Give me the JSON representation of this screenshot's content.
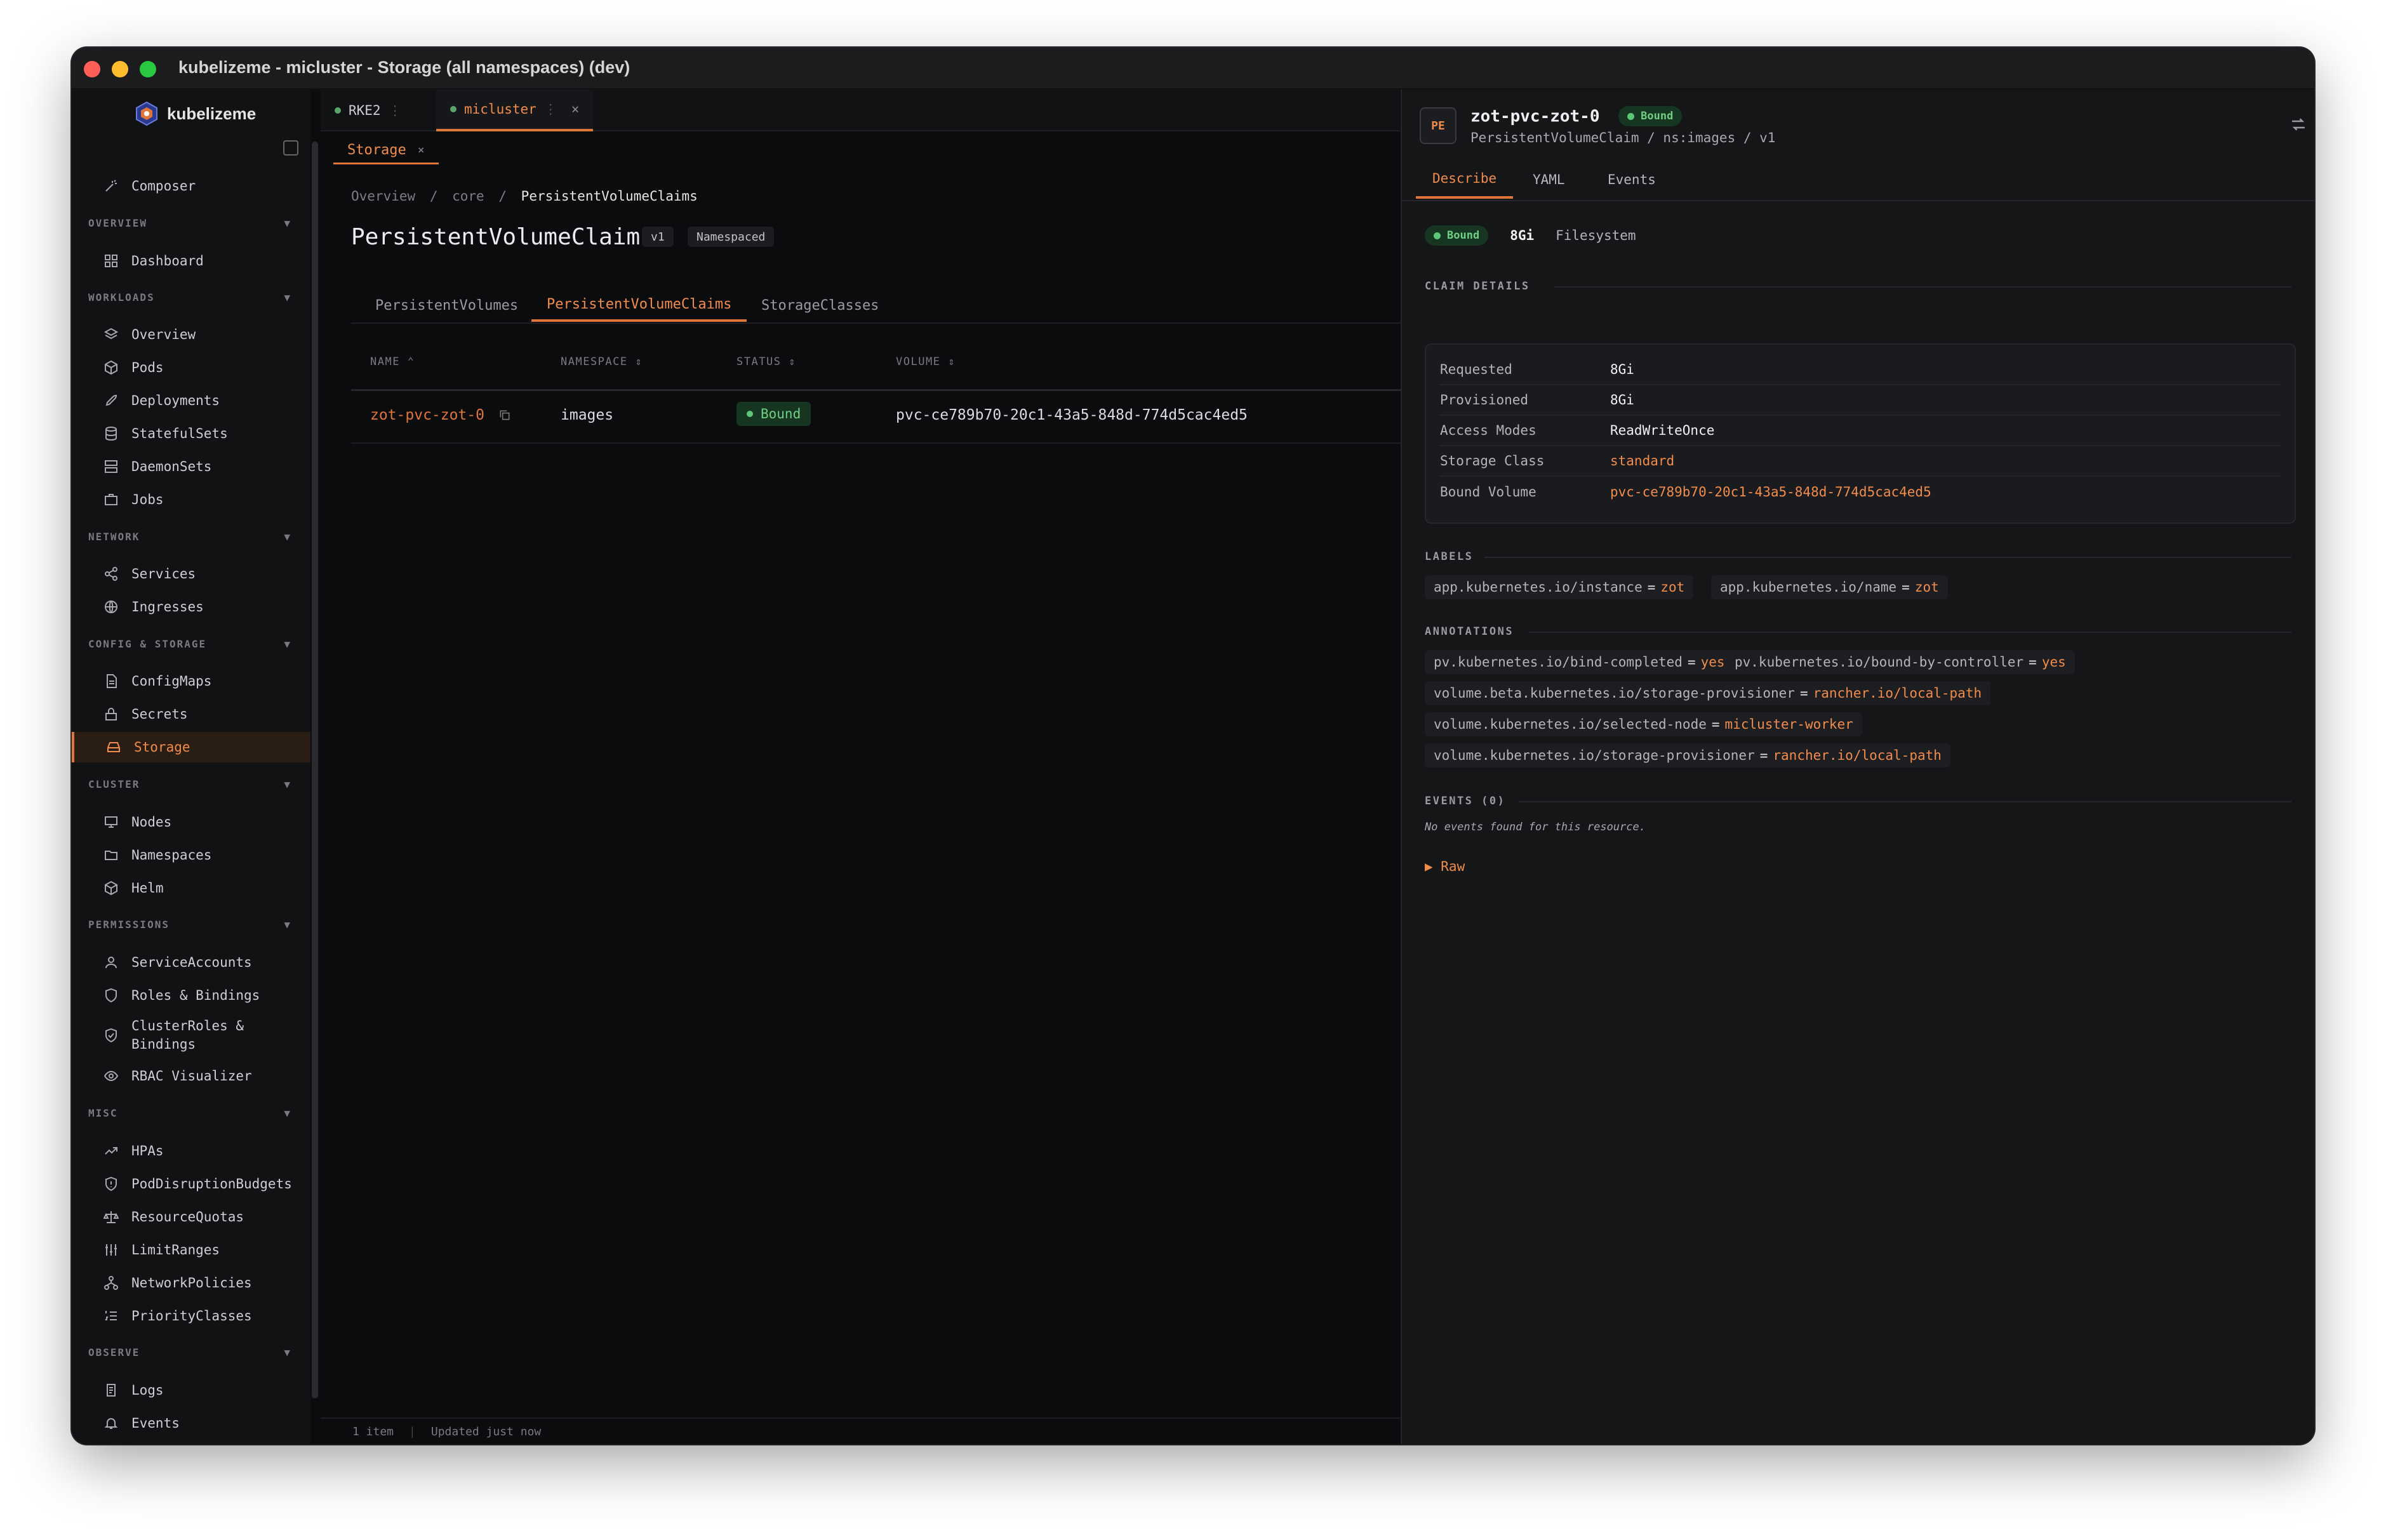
{
  "window": {
    "title": "kubelizeme - micluster - Storage (all namespaces) (dev)",
    "colors": {
      "red": "#ff5f57",
      "yellow": "#febc2e",
      "green": "#28c840"
    }
  },
  "app": {
    "name": "kubelizeme"
  },
  "sidebar": {
    "composer": "Composer",
    "sections": {
      "overview": "OVERVIEW",
      "workloads": "WORKLOADS",
      "network": "NETWORK",
      "config": "CONFIG & STORAGE",
      "cluster": "CLUSTER",
      "permissions": "PERMISSIONS",
      "misc": "MISC",
      "observe": "OBSERVE"
    },
    "chevron": "▼",
    "items": {
      "dashboard": "Dashboard",
      "overview": "Overview",
      "pods": "Pods",
      "deployments": "Deployments",
      "statefulsets": "StatefulSets",
      "daemonsets": "DaemonSets",
      "jobs": "Jobs",
      "services": "Services",
      "ingresses": "Ingresses",
      "configmaps": "ConfigMaps",
      "secrets": "Secrets",
      "storage": "Storage",
      "nodes": "Nodes",
      "namespaces": "Namespaces",
      "helm": "Helm",
      "serviceaccounts": "ServiceAccounts",
      "roles": "Roles & Bindings",
      "clusterroles_1": "ClusterRoles &",
      "clusterroles_2": "Bindings",
      "rbac": "RBAC Visualizer",
      "hpas": "HPAs",
      "pdb": "PodDisruptionBudgets",
      "quotas": "ResourceQuotas",
      "limits": "LimitRanges",
      "netpol": "NetworkPolicies",
      "priority": "PriorityClasses",
      "logs": "Logs",
      "events": "Events"
    }
  },
  "cluster_tabs": [
    {
      "label": "RKE2",
      "sep": "⋮"
    },
    {
      "label": "micluster",
      "sep": "⋮",
      "close": "×"
    }
  ],
  "view_tab": {
    "label": "Storage",
    "close": "×"
  },
  "breadcrumb": {
    "a": "Overview",
    "b": "core",
    "c": "PersistentVolumeClaims",
    "sep": "/"
  },
  "page": {
    "title": "PersistentVolumeClaims",
    "version": "v1",
    "scope": "Namespaced"
  },
  "resource_tabs": [
    "PersistentVolumes",
    "PersistentVolumeClaims",
    "StorageClasses"
  ],
  "table": {
    "headers": {
      "name": "NAME ⌃",
      "namespace": "NAMESPACE ⇕",
      "status": "STATUS ⇕",
      "volume": "VOLUME ⇕"
    },
    "rows": [
      {
        "name": "zot-pvc-zot-0",
        "namespace": "images",
        "status": "Bound",
        "volume": "pvc-ce789b70-20c1-43a5-848d-774d5cac4ed5"
      }
    ]
  },
  "footer": {
    "count": "1 item",
    "sep": "|",
    "updated": "Updated just now"
  },
  "detail": {
    "badge": "PE",
    "title": "zot-pvc-zot-0",
    "status": "Bound",
    "subtitle": "PersistentVolumeClaim / ns:images / v1",
    "tabs": [
      "Describe",
      "YAML",
      "Events"
    ],
    "summary": {
      "status": "Bound",
      "size": "8Gi",
      "mode": "Filesystem"
    },
    "claim_heading": "CLAIM DETAILS",
    "claim": [
      {
        "k": "Requested",
        "v": "8Gi"
      },
      {
        "k": "Provisioned",
        "v": "8Gi"
      },
      {
        "k": "Access Modes",
        "v": "ReadWriteOnce"
      },
      {
        "k": "Storage Class",
        "v": "standard"
      },
      {
        "k": "Bound Volume",
        "v": "pvc-ce789b70-20c1-43a5-848d-774d5cac4ed5"
      }
    ],
    "labels_heading": "LABELS",
    "labels": [
      {
        "k": "app.kubernetes.io/instance",
        "v": "zot"
      },
      {
        "k": "app.kubernetes.io/name",
        "v": "zot"
      }
    ],
    "annotations_heading": "ANNOTATIONS",
    "annotations": [
      {
        "k": "pv.kubernetes.io/bind-completed",
        "v": "yes"
      },
      {
        "k": "pv.kubernetes.io/bound-by-controller",
        "v": "yes"
      },
      {
        "k": "volume.beta.kubernetes.io/storage-provisioner",
        "v": "rancher.io/local-path"
      },
      {
        "k": "volume.kubernetes.io/selected-node",
        "v": "micluster-worker"
      },
      {
        "k": "volume.kubernetes.io/storage-provisioner",
        "v": "rancher.io/local-path"
      }
    ],
    "eq": "=",
    "events_heading": "EVENTS (0)",
    "events_empty": "No events found for this resource.",
    "raw": "▶ Raw"
  }
}
